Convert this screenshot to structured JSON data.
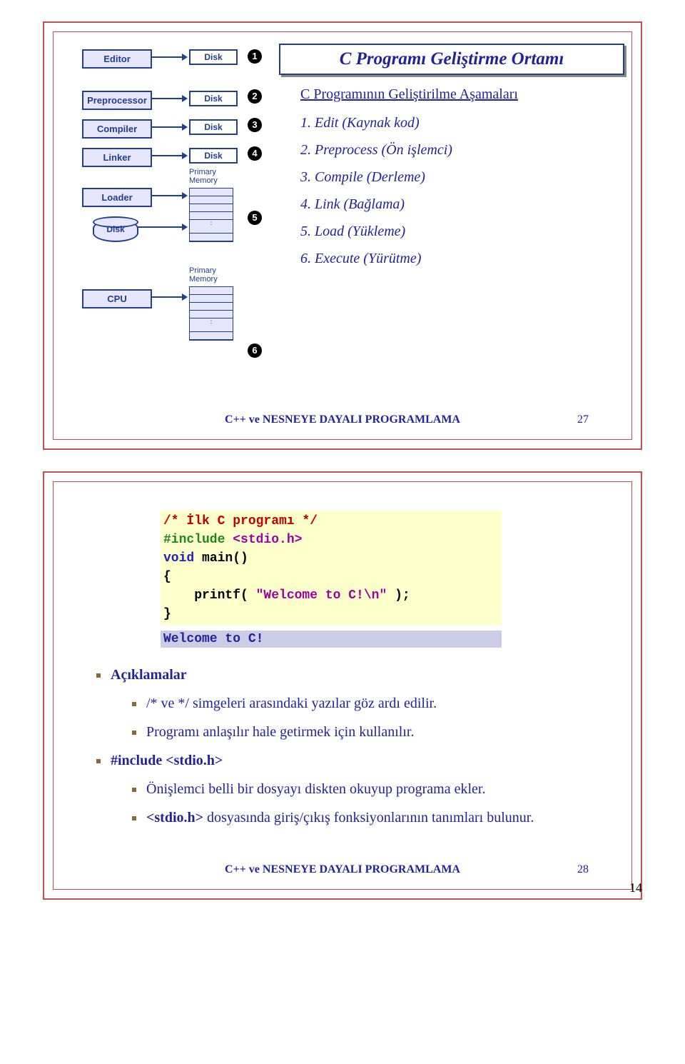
{
  "slide27": {
    "title": "C Programı Geliştirme Ortamı",
    "subtitle": "C Programının Geliştirilme Aşamaları",
    "stages": {
      "editor": "Editor",
      "preprocessor": "Preprocessor",
      "compiler": "Compiler",
      "linker": "Linker",
      "loader": "Loader",
      "disk_lower": "Disk",
      "cpu": "CPU"
    },
    "disk_label": "Disk",
    "mem_label": "Primary\nMemory",
    "numbers": {
      "n1": "1",
      "n2": "2",
      "n3": "3",
      "n4": "4",
      "n5": "5",
      "n6": "6"
    },
    "steps": [
      "1.  Edit  (Kaynak kod)",
      "2.  Preprocess (Ön işlemci)",
      "3.  Compile (Derleme)",
      "4.  Link (Bağlama)",
      "5.  Load (Yükleme)",
      "6.  Execute (Yürütme)"
    ],
    "footer": "C++ ve NESNEYE DAYALI PROGRAMLAMA",
    "slidenum": "27"
  },
  "slide28": {
    "code": {
      "line1a": "/* İlk C programı */",
      "line2a": "#include ",
      "line2b": "<stdio.h>",
      "line3a": "void",
      "line3b": " main()",
      "line4": "{",
      "line5a": "    printf( ",
      "line5b": "\"Welcome to C!\\n\"",
      "line5c": " );",
      "line6": "}"
    },
    "output": "Welcome to C!",
    "b_aciklamalar": "Açıklamalar",
    "b_comment": "/* ve */ simgeleri arasındaki yazılar göz ardı edilir.",
    "b_anlas": "Programı anlaşılır hale getirmek için kullanılır.",
    "b_include_head": "#include <stdio.h>",
    "b_onislemci": "Önişlemci belli bir dosyayı diskten okuyup programa ekler.",
    "b_stdio_pre": "<stdio.h>",
    "b_stdio_rest": " dosyasında giriş/çıkış fonksiyonlarının tanımları bulunur.",
    "footer": "C++ ve NESNEYE DAYALI PROGRAMLAMA",
    "slidenum": "28"
  },
  "page_number": "14"
}
